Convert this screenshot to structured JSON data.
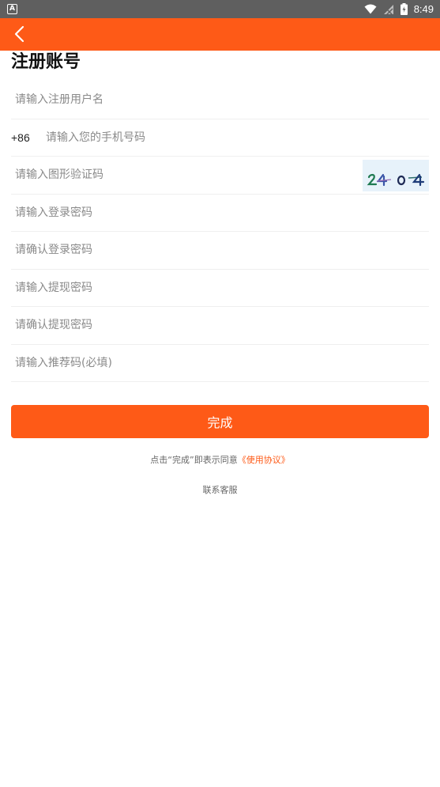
{
  "status_bar": {
    "notification_letter": "A",
    "time": "8:49"
  },
  "header": {
    "back_icon": "chevron-left-icon",
    "bg_color": "#fe5a17"
  },
  "page": {
    "title": "注册账号"
  },
  "form": {
    "username_placeholder": "请输入注册用户名",
    "phone_prefix": "+86",
    "phone_placeholder": "请输入您的手机号码",
    "captcha_placeholder": "请输入图形验证码",
    "captcha_code": "2404",
    "login_password_placeholder": "请输入登录密码",
    "confirm_login_password_placeholder": "请确认登录密码",
    "withdraw_password_placeholder": "请输入提现密码",
    "confirm_withdraw_password_placeholder": "请确认提现密码",
    "referral_placeholder": "请输入推荐码(必填)"
  },
  "submit_label": "完成",
  "agreement": {
    "prefix": "点击“完成”即表示同意",
    "link": "《使用协议》"
  },
  "customer_service": "联系客服",
  "colors": {
    "accent": "#fe5a17"
  }
}
